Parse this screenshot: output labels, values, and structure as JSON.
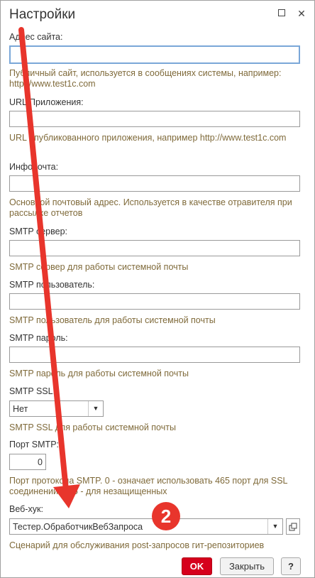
{
  "window": {
    "title": "Настройки"
  },
  "fields": {
    "site_label": "Адрес сайта:",
    "site_hint": "Публичный сайт, используется в сообщениях системы, например: http://www.test1c.com",
    "app_label": "URL Приложения:",
    "app_hint": "URL опубликованного приложения, например http://www.test1c.com",
    "mail_label": "Инфопочта:",
    "mail_hint": "Основной почтовый адрес. Используется в качестве отравителя при рассылке отчетов",
    "smtp_server_label": "SMTP сервер:",
    "smtp_server_hint": "SMTP сервер для работы системной почты",
    "smtp_user_label": "SMTP пользователь:",
    "smtp_user_hint": "SMTP пользователь для работы системной почты",
    "smtp_pass_label": "SMTP пароль:",
    "smtp_pass_hint": "SMTP пароль для работы системной почты",
    "smtp_ssl_label": "SMTP SSL:",
    "smtp_ssl_value": "Нет",
    "smtp_ssl_hint": "SMTP SSL для работы системной почты",
    "smtp_port_label": "Порт SMTP:",
    "smtp_port_value": "0",
    "smtp_port_hint": "Порт протокола SMTP. 0 - означает использовать 465 порт для SSL соединений и 25 - для незащищенных",
    "webhook_label": "Веб-хук:",
    "webhook_value": "Тестер.ОбработчикВебЗапроса",
    "webhook_hint": "Сценарий для обслуживания post-запросов гит-репозиториев"
  },
  "buttons": {
    "ok": "OK",
    "close": "Закрыть",
    "help": "?"
  },
  "annotation": {
    "badge": "2"
  },
  "colors": {
    "accent": "#d6001c",
    "hint": "#7f6a3a",
    "arrow": "#e8352c"
  }
}
